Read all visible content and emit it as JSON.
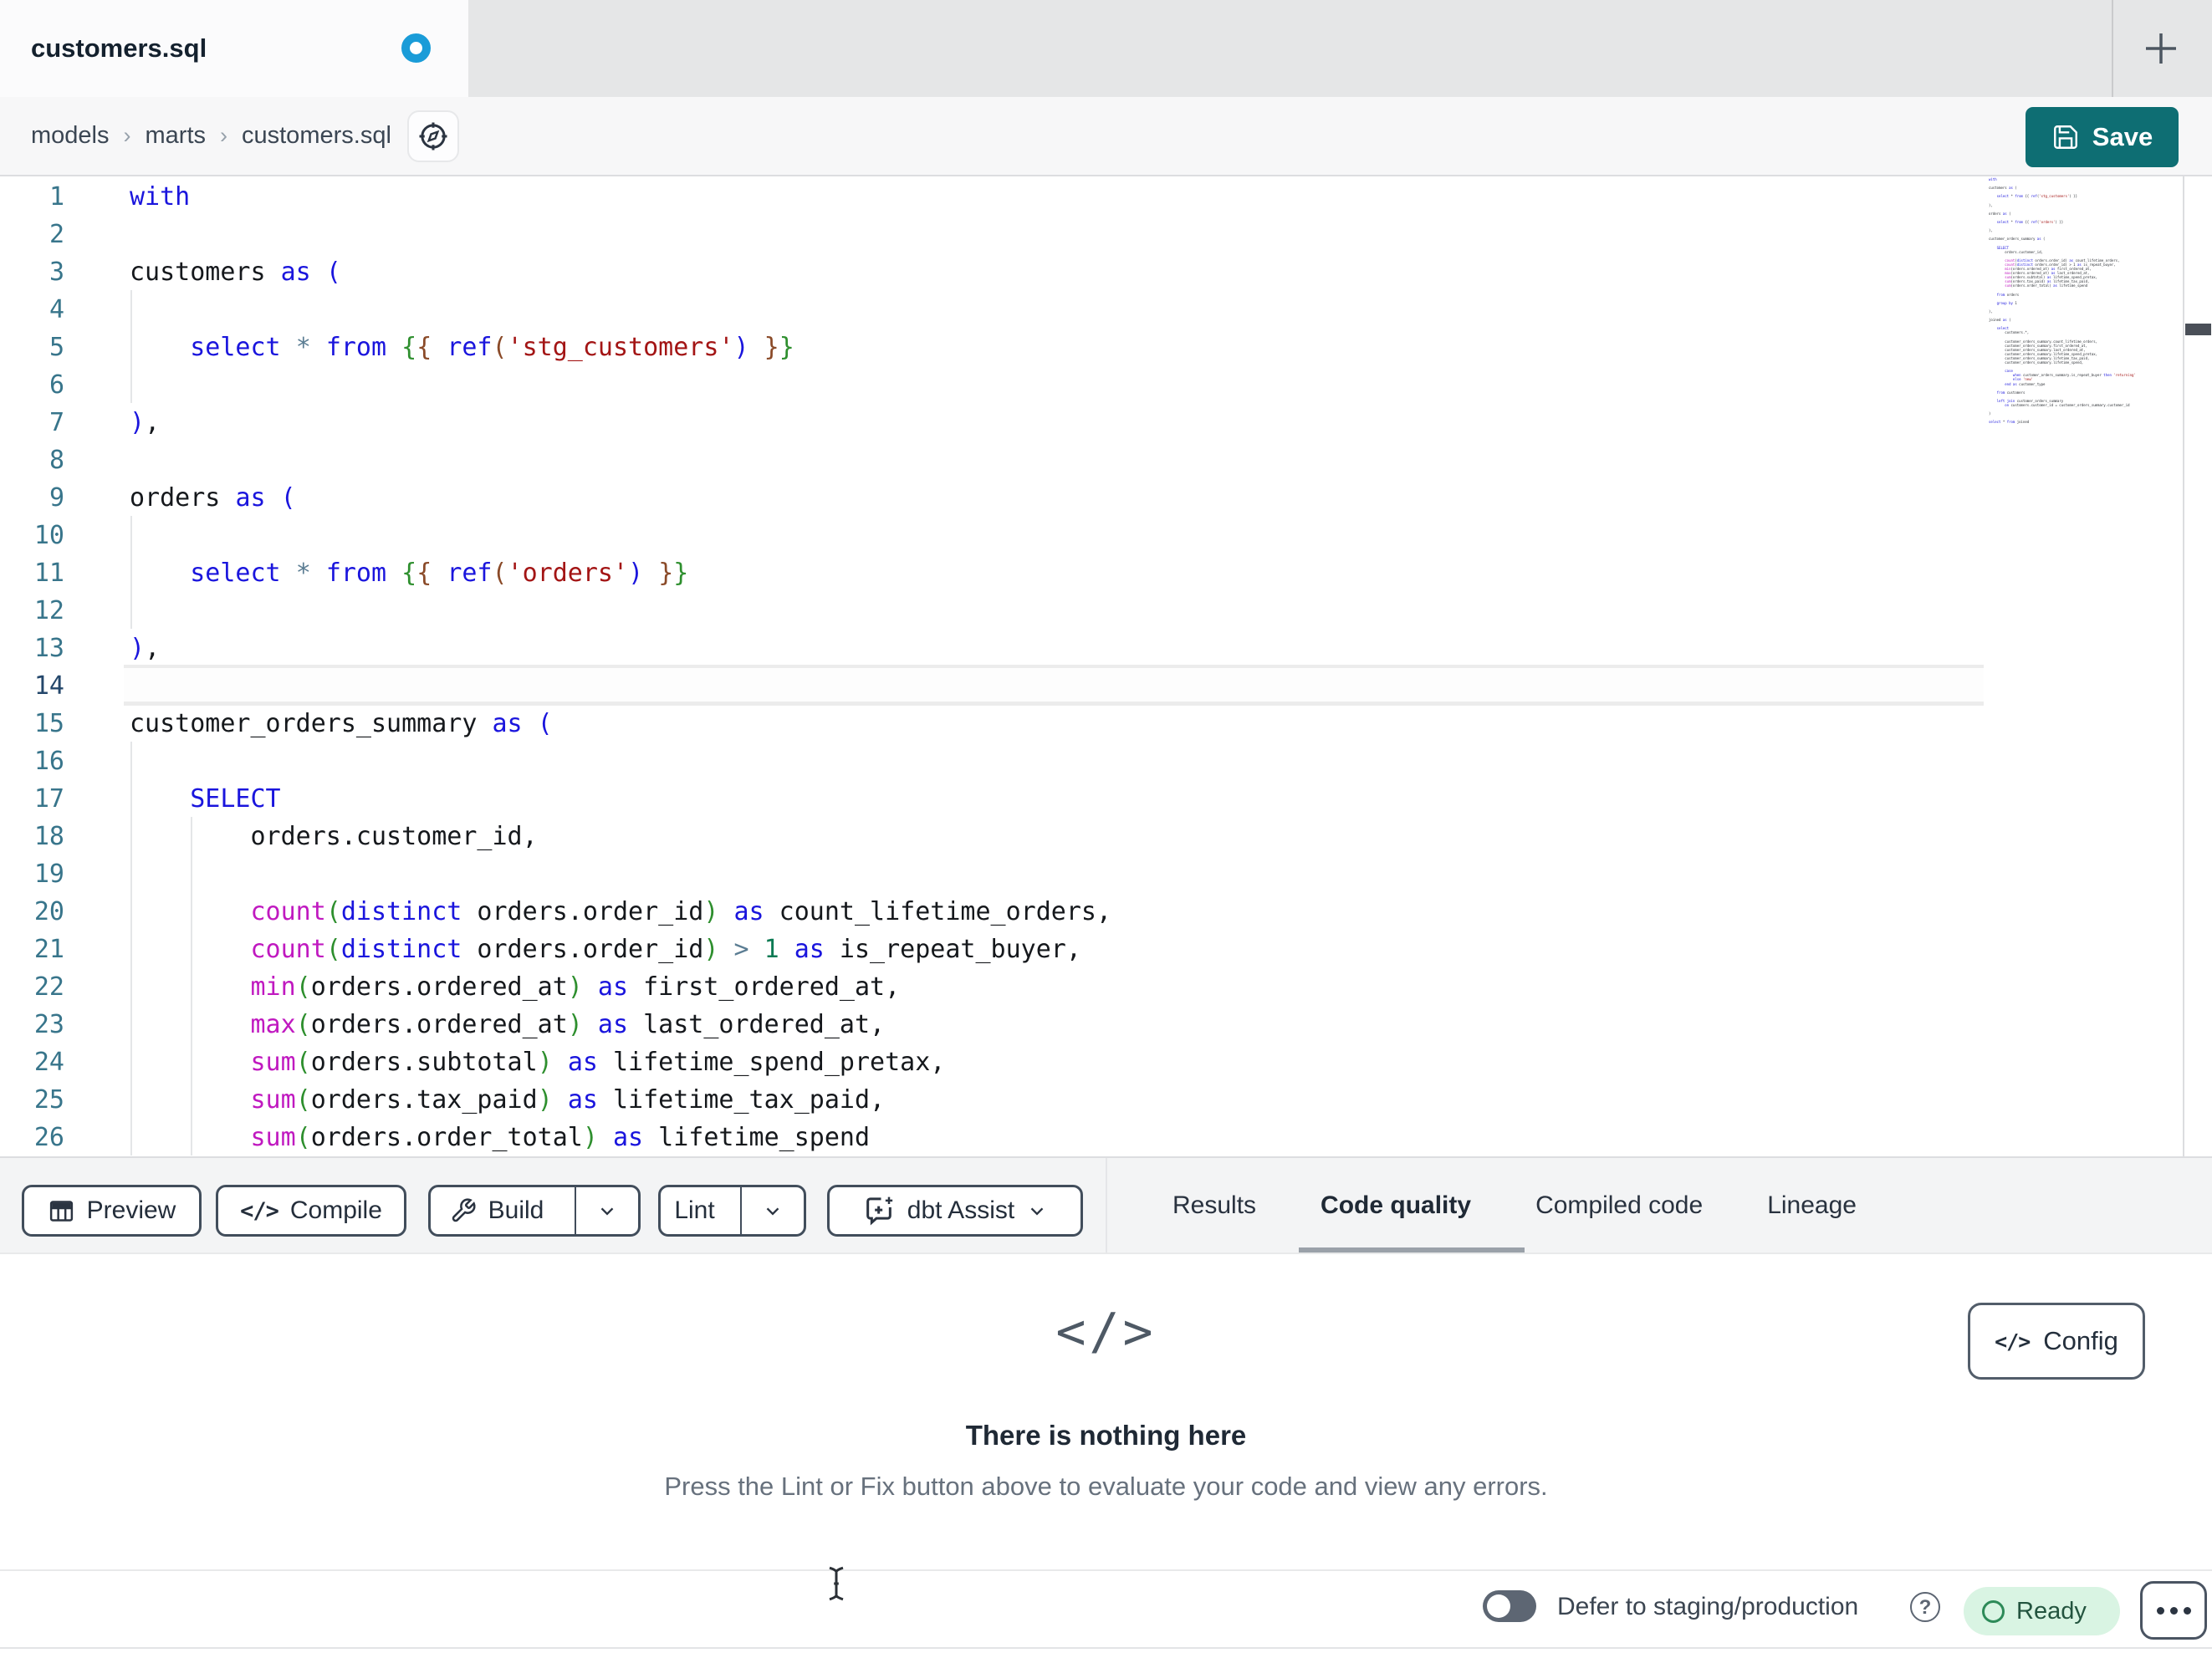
{
  "tab_bar": {
    "tab_title": "customers.sql",
    "unsaved": true,
    "new_tab_label": "+"
  },
  "breadcrumb": {
    "items": [
      "models",
      "marts",
      "customers.sql"
    ],
    "separator": "›"
  },
  "actions": {
    "save_label": "Save"
  },
  "editor": {
    "active_line": 14,
    "lines": [
      {
        "n": 1,
        "t": [
          [
            "with",
            "kw"
          ]
        ]
      },
      {
        "n": 2,
        "t": []
      },
      {
        "n": 3,
        "t": [
          [
            "customers ",
            "id"
          ],
          [
            "as",
            "kw"
          ],
          [
            " ",
            "id"
          ],
          [
            "(",
            "kw"
          ]
        ]
      },
      {
        "n": 4,
        "t": []
      },
      {
        "n": 5,
        "t": [
          [
            "    ",
            "id"
          ],
          [
            "select",
            "kw"
          ],
          [
            " ",
            "id"
          ],
          [
            "*",
            "op"
          ],
          [
            " ",
            "id"
          ],
          [
            "from",
            "kw"
          ],
          [
            " ",
            "id"
          ],
          [
            "{",
            "jg"
          ],
          [
            "{",
            "jb"
          ],
          [
            " ",
            "id"
          ],
          [
            "ref",
            "kw"
          ],
          [
            "(",
            "jb"
          ],
          [
            "'stg_customers'",
            "str"
          ],
          [
            ")",
            "kw"
          ],
          [
            " ",
            "id"
          ],
          [
            "}",
            "jb"
          ],
          [
            "}",
            "jg"
          ]
        ]
      },
      {
        "n": 6,
        "t": []
      },
      {
        "n": 7,
        "t": [
          [
            ")",
            "kw"
          ],
          [
            ",",
            "id"
          ]
        ]
      },
      {
        "n": 8,
        "t": []
      },
      {
        "n": 9,
        "t": [
          [
            "orders ",
            "id"
          ],
          [
            "as",
            "kw"
          ],
          [
            " ",
            "id"
          ],
          [
            "(",
            "kw"
          ]
        ]
      },
      {
        "n": 10,
        "t": []
      },
      {
        "n": 11,
        "t": [
          [
            "    ",
            "id"
          ],
          [
            "select",
            "kw"
          ],
          [
            " ",
            "id"
          ],
          [
            "*",
            "op"
          ],
          [
            " ",
            "id"
          ],
          [
            "from",
            "kw"
          ],
          [
            " ",
            "id"
          ],
          [
            "{",
            "jg"
          ],
          [
            "{",
            "jb"
          ],
          [
            " ",
            "id"
          ],
          [
            "ref",
            "kw"
          ],
          [
            "(",
            "jb"
          ],
          [
            "'orders'",
            "str"
          ],
          [
            ")",
            "kw"
          ],
          [
            " ",
            "id"
          ],
          [
            "}",
            "jb"
          ],
          [
            "}",
            "jg"
          ]
        ]
      },
      {
        "n": 12,
        "t": []
      },
      {
        "n": 13,
        "t": [
          [
            ")",
            "kw"
          ],
          [
            ",",
            "id"
          ]
        ]
      },
      {
        "n": 14,
        "t": []
      },
      {
        "n": 15,
        "t": [
          [
            "customer_orders_summary ",
            "id"
          ],
          [
            "as",
            "kw"
          ],
          [
            " ",
            "id"
          ],
          [
            "(",
            "kw"
          ]
        ]
      },
      {
        "n": 16,
        "t": []
      },
      {
        "n": 17,
        "t": [
          [
            "    ",
            "id"
          ],
          [
            "SELECT",
            "kw"
          ]
        ]
      },
      {
        "n": 18,
        "t": [
          [
            "        orders.customer_id,",
            "id"
          ]
        ]
      },
      {
        "n": 19,
        "t": []
      },
      {
        "n": 20,
        "t": [
          [
            "        ",
            "id"
          ],
          [
            "count",
            "fn"
          ],
          [
            "(",
            "jg"
          ],
          [
            "distinct",
            "kw"
          ],
          [
            " orders.order_id",
            "id"
          ],
          [
            ")",
            "jg"
          ],
          [
            " ",
            "id"
          ],
          [
            "as",
            "kw"
          ],
          [
            " count_lifetime_orders,",
            "id"
          ]
        ]
      },
      {
        "n": 21,
        "t": [
          [
            "        ",
            "id"
          ],
          [
            "count",
            "fn"
          ],
          [
            "(",
            "jg"
          ],
          [
            "distinct",
            "kw"
          ],
          [
            " orders.order_id",
            "id"
          ],
          [
            ")",
            "jg"
          ],
          [
            " ",
            "id"
          ],
          [
            ">",
            "op"
          ],
          [
            " ",
            "id"
          ],
          [
            "1",
            "num"
          ],
          [
            " ",
            "id"
          ],
          [
            "as",
            "kw"
          ],
          [
            " is_repeat_buyer,",
            "id"
          ]
        ]
      },
      {
        "n": 22,
        "t": [
          [
            "        ",
            "id"
          ],
          [
            "min",
            "fn"
          ],
          [
            "(",
            "jg"
          ],
          [
            "orders.ordered_at",
            "id"
          ],
          [
            ")",
            "jg"
          ],
          [
            " ",
            "id"
          ],
          [
            "as",
            "kw"
          ],
          [
            " first_ordered_at,",
            "id"
          ]
        ]
      },
      {
        "n": 23,
        "t": [
          [
            "        ",
            "id"
          ],
          [
            "max",
            "fn"
          ],
          [
            "(",
            "jg"
          ],
          [
            "orders.ordered_at",
            "id"
          ],
          [
            ")",
            "jg"
          ],
          [
            " ",
            "id"
          ],
          [
            "as",
            "kw"
          ],
          [
            " last_ordered_at,",
            "id"
          ]
        ]
      },
      {
        "n": 24,
        "t": [
          [
            "        ",
            "id"
          ],
          [
            "sum",
            "fn"
          ],
          [
            "(",
            "jg"
          ],
          [
            "orders.subtotal",
            "id"
          ],
          [
            ")",
            "jg"
          ],
          [
            " ",
            "id"
          ],
          [
            "as",
            "kw"
          ],
          [
            " lifetime_spend_pretax,",
            "id"
          ]
        ]
      },
      {
        "n": 25,
        "t": [
          [
            "        ",
            "id"
          ],
          [
            "sum",
            "fn"
          ],
          [
            "(",
            "jg"
          ],
          [
            "orders.tax_paid",
            "id"
          ],
          [
            ")",
            "jg"
          ],
          [
            " ",
            "id"
          ],
          [
            "as",
            "kw"
          ],
          [
            " lifetime_tax_paid,",
            "id"
          ]
        ]
      },
      {
        "n": 26,
        "t": [
          [
            "        ",
            "id"
          ],
          [
            "sum",
            "fn"
          ],
          [
            "(",
            "jg"
          ],
          [
            "orders.order_total",
            "id"
          ],
          [
            ")",
            "jg"
          ],
          [
            " ",
            "id"
          ],
          [
            "as",
            "kw"
          ],
          [
            " lifetime_spend",
            "id"
          ]
        ]
      }
    ]
  },
  "minimap": {
    "code": "with\n\ncustomers as (\n\n    select * from {{ ref('stg_customers') }}\n\n),\n\norders as (\n\n    select * from {{ ref('orders') }}\n\n),\n\ncustomer_orders_summary as (\n\n    SELECT\n        orders.customer_id,\n\n        count(distinct orders.order_id) as count_lifetime_orders,\n        count(distinct orders.order_id) > 1 as is_repeat_buyer,\n        min(orders.ordered_at) as first_ordered_at,\n        max(orders.ordered_at) as last_ordered_at,\n        sum(orders.subtotal) as lifetime_spend_pretax,\n        sum(orders.tax_paid) as lifetime_tax_paid,\n        sum(orders.order_total) as lifetime_spend\n\n    from orders\n\n    group by 1\n\n),\n\njoined as (\n\n    select\n        customers.*,\n\n        customer_orders_summary.count_lifetime_orders,\n        customer_orders_summary.first_ordered_at,\n        customer_orders_summary.last_ordered_at,\n        customer_orders_summary.lifetime_spend_pretax,\n        customer_orders_summary.lifetime_tax_paid,\n        customer_orders_summary.lifetime_spend,\n\n        case\n            when customer_orders_summary.is_repeat_buyer then 'returning'\n            else 'new'\n        end as customer_type\n\n    from customers\n\n    left join customer_orders_summary\n        on customers.customer_id = customer_orders_summary.customer_id\n\n)\n\nselect * from joined"
  },
  "toolbar": {
    "preview": "Preview",
    "compile": "Compile",
    "build": "Build",
    "lint": "Lint",
    "assist": "dbt Assist"
  },
  "result_tabs": [
    {
      "label": "Results",
      "active": false
    },
    {
      "label": "Code quality",
      "active": true
    },
    {
      "label": "Compiled code",
      "active": false
    },
    {
      "label": "Lineage",
      "active": false
    }
  ],
  "code_quality_panel": {
    "empty_icon_glyph": "</>",
    "title": "There is nothing here",
    "subtitle": "Press the Lint or Fix button above to evaluate your code and view any errors.",
    "config_label": "Config",
    "config_icon_glyph": "</>"
  },
  "status_bar": {
    "defer_label": "Defer to staging/production",
    "help_glyph": "?",
    "ready_label": "Ready"
  },
  "icons": {
    "tab_unsaved": "unsaved-dot-icon",
    "new_tab": "plus-icon",
    "breadcrumb_button": "compass-icon",
    "save": "floppy-disk-icon",
    "preview": "table-grid-icon",
    "compile": "code-icon",
    "build": "wrench-icon",
    "assist": "chat-sparkle-icon",
    "dropdowns": "chevron-down-icon",
    "help": "question-circle-icon",
    "ready": "status-circle-icon",
    "more": "ellipsis-icon",
    "mouse": "i-beam-cursor"
  },
  "colors": {
    "accent_teal": "#0e6e73",
    "unsaved_dot_blue": "#1a9cd8",
    "ready_bg": "#d9f4e3",
    "ready_green": "#2d8a58",
    "tabbar_gray": "#e5e6e7",
    "toolbar_gray": "#f3f4f5"
  }
}
